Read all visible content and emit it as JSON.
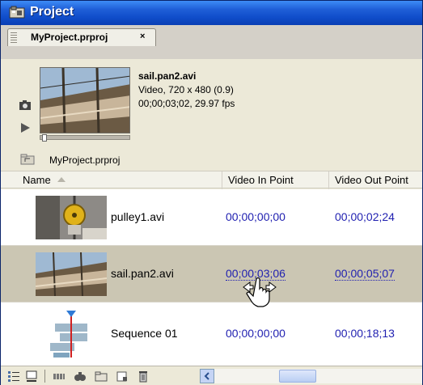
{
  "window": {
    "title": "Project"
  },
  "tab": {
    "label": "MyProject.prproj",
    "close_glyph": "×"
  },
  "preview": {
    "clip_name": "sail.pan2.avi",
    "info_type": "Video, 720 x 480 (0.9)",
    "info_duration": "00;00;03;02, 29.97 fps"
  },
  "path": {
    "label": "MyProject.prproj"
  },
  "columns": {
    "name": "Name",
    "video_in": "Video In Point",
    "video_out": "Video Out Point"
  },
  "rows": [
    {
      "name": "pulley1.avi",
      "in_point": "00;00;00;00",
      "out_point": "00;00;02;24"
    },
    {
      "name": "sail.pan2.avi",
      "in_point": "00;00;03;06",
      "out_point": "00;00;05;07"
    },
    {
      "name": "Sequence 01",
      "in_point": "00;00;00;00",
      "out_point": "00;00;18;13"
    }
  ],
  "colors": {
    "title_bar": "#0f4cc9",
    "selected_row": "#cbc6b3",
    "timecode_link": "#1f1fb0"
  },
  "icons": [
    "project-icon",
    "camera-icon",
    "play-icon",
    "folder-up-icon",
    "list-view-icon",
    "icon-view-icon",
    "automate-to-sequence-icon",
    "find-icon",
    "new-bin-icon",
    "new-item-icon",
    "delete-icon",
    "scroll-left-icon",
    "scrub-hand-cursor-icon"
  ]
}
